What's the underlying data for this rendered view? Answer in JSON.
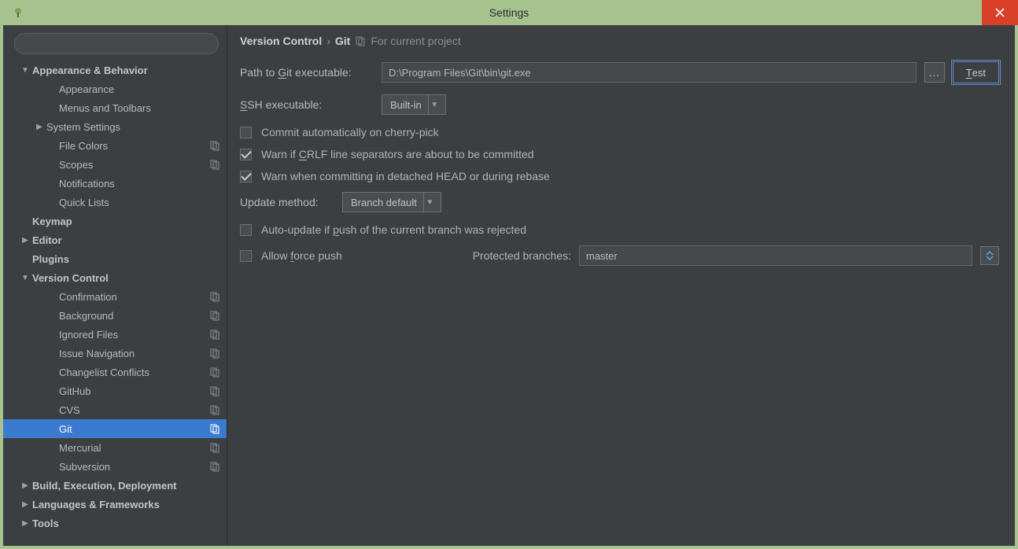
{
  "window": {
    "title": "Settings"
  },
  "breadcrumb": {
    "parent": "Version Control",
    "current": "Git",
    "scope": "For current project"
  },
  "sidebar": {
    "items": [
      {
        "label": "Appearance & Behavior",
        "level": 0,
        "bold": true,
        "arrow": "down"
      },
      {
        "label": "Appearance",
        "level": 2
      },
      {
        "label": "Menus and Toolbars",
        "level": 2
      },
      {
        "label": "System Settings",
        "level": 1,
        "arrow": "right"
      },
      {
        "label": "File Colors",
        "level": 2,
        "proj": true
      },
      {
        "label": "Scopes",
        "level": 2,
        "proj": true
      },
      {
        "label": "Notifications",
        "level": 2
      },
      {
        "label": "Quick Lists",
        "level": 2
      },
      {
        "label": "Keymap",
        "level": 0,
        "bold": true
      },
      {
        "label": "Editor",
        "level": 0,
        "bold": true,
        "arrow": "right"
      },
      {
        "label": "Plugins",
        "level": 0,
        "bold": true
      },
      {
        "label": "Version Control",
        "level": 0,
        "bold": true,
        "arrow": "down"
      },
      {
        "label": "Confirmation",
        "level": 2,
        "proj": true
      },
      {
        "label": "Background",
        "level": 2,
        "proj": true
      },
      {
        "label": "Ignored Files",
        "level": 2,
        "proj": true
      },
      {
        "label": "Issue Navigation",
        "level": 2,
        "proj": true
      },
      {
        "label": "Changelist Conflicts",
        "level": 2,
        "proj": true
      },
      {
        "label": "GitHub",
        "level": 2,
        "proj": true
      },
      {
        "label": "CVS",
        "level": 2,
        "proj": true
      },
      {
        "label": "Git",
        "level": 2,
        "proj": true,
        "selected": true
      },
      {
        "label": "Mercurial",
        "level": 2,
        "proj": true
      },
      {
        "label": "Subversion",
        "level": 2,
        "proj": true
      },
      {
        "label": "Build, Execution, Deployment",
        "level": 0,
        "bold": true,
        "arrow": "right"
      },
      {
        "label": "Languages & Frameworks",
        "level": 0,
        "bold": true,
        "arrow": "right"
      },
      {
        "label": "Tools",
        "level": 0,
        "bold": true,
        "arrow": "right"
      }
    ]
  },
  "form": {
    "pathLabelPrefix": "Path to ",
    "pathLabelUnderline": "G",
    "pathLabelSuffix": "it executable:",
    "pathValue": "D:\\Program Files\\Git\\bin\\git.exe",
    "browse": "...",
    "test": "Test",
    "testUnderline": "T",
    "testSuffix": "est",
    "sshLabelUnderline": "S",
    "sshLabelSuffix": "SH executable:",
    "sshValue": "Built-in",
    "cherryPick": "Commit automatically on cherry-pick",
    "crlfPrefix": "Warn if ",
    "crlfUnderline": "C",
    "crlfSuffix": "RLF line separators are about to be committed",
    "detached": "Warn when committing in detached HEAD or during rebase",
    "updateLabel": "Update method:",
    "updateValue": "Branch default",
    "autoUpdatePrefix": "Auto-update if ",
    "autoUpdateUnderline": "p",
    "autoUpdateSuffix": "ush of the current branch was rejected",
    "forcePrefix": "Allow ",
    "forceUnderline": "f",
    "forceSuffix": "orce push",
    "protectedLabel": "Protected branches:",
    "protectedValue": "master"
  }
}
